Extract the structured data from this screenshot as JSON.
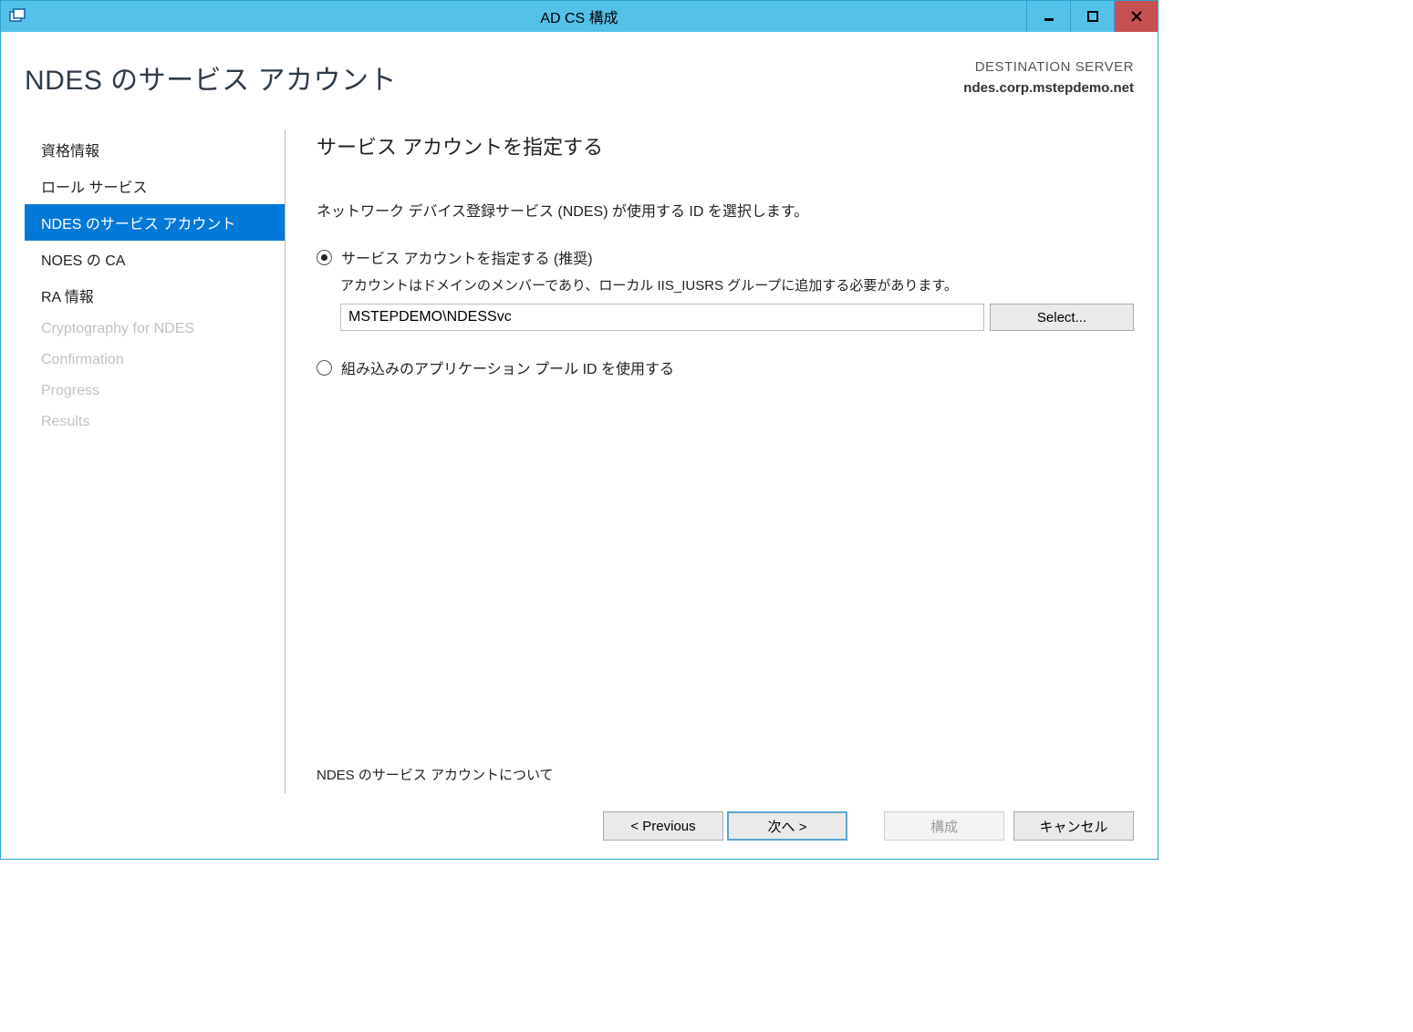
{
  "window": {
    "title": "AD CS 構成"
  },
  "header": {
    "page_title": "NDES のサービス アカウント",
    "dest_label": "DESTINATION SERVER",
    "dest_server": "ndes.corp.mstepdemo.net"
  },
  "sidebar": {
    "items": [
      {
        "label": "資格情報",
        "state": "normal"
      },
      {
        "label": "ロール サービス",
        "state": "normal"
      },
      {
        "label": "NDES のサービス アカウント",
        "state": "selected"
      },
      {
        "label": "NOES の CA",
        "state": "normal"
      },
      {
        "label": "RA 情報",
        "state": "normal"
      },
      {
        "label": "Cryptography for NDES",
        "state": "disabled"
      },
      {
        "label": "Confirmation",
        "state": "disabled"
      },
      {
        "label": "Progress",
        "state": "disabled"
      },
      {
        "label": "Results",
        "state": "disabled"
      }
    ]
  },
  "main": {
    "heading": "サービス アカウントを指定する",
    "instruction": "ネットワーク デバイス登録サービス (NDES) が使用する ID を選択します。",
    "radio1_label": "サービス アカウントを指定する (推奨)",
    "radio1_note": "アカウントはドメインのメンバーであり、ローカル IIS_IUSRS グループに追加する必要があります。",
    "account_value": "MSTEPDEMO\\NDESSvc",
    "select_button": "Select...",
    "radio2_label": "組み込みのアプリケーション プール ID を使用する",
    "info_link": "NDES のサービス アカウントについて"
  },
  "footer": {
    "previous": "< Previous",
    "next": "次へ >",
    "configure": "構成",
    "cancel": "キャンセル"
  }
}
